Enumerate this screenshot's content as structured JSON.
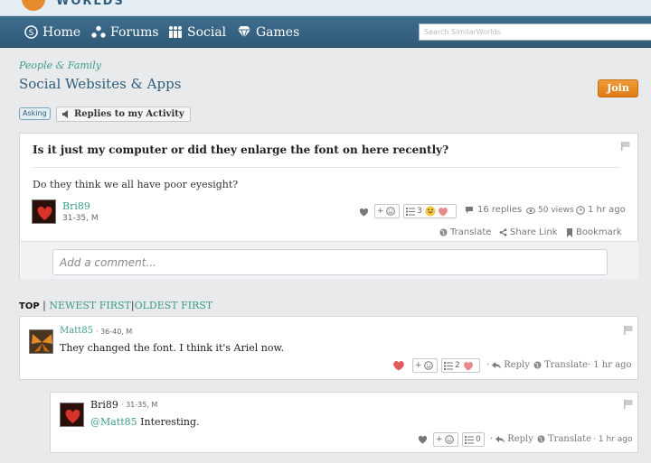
{
  "header": {
    "logo_text": "WORLDS",
    "nav": [
      {
        "label": "Home",
        "icon": "home-icon"
      },
      {
        "label": "Forums",
        "icon": "forums-icon"
      },
      {
        "label": "Social",
        "icon": "social-icon"
      },
      {
        "label": "Games",
        "icon": "games-icon"
      }
    ],
    "search_placeholder": "Search SimilarWorlds"
  },
  "group": {
    "category": "People & Family",
    "title": "Social Websites & Apps",
    "join_label": "Join"
  },
  "filters": {
    "asking_badge": "Asking",
    "replies_button": "Replies to my Activity"
  },
  "question": {
    "title": "Is it just my computer or did they enlarge the font on here recently?",
    "body": "Do they think we all have poor eyesight?",
    "author": {
      "name": "Bri89",
      "meta": "31-35, M"
    },
    "add_reaction": "+",
    "reactions_count": "3",
    "replies": "16 replies",
    "views": "50 views",
    "time": "1 hr ago",
    "translate": "Translate",
    "share": "Share Link",
    "bookmark": "Bookmark",
    "comment_placeholder": "Add a comment..."
  },
  "sort": {
    "top": "TOP",
    "newest": "NEWEST FIRST",
    "oldest": "OLDEST FIRST",
    "sep": "|"
  },
  "replies": [
    {
      "author": "Matt85",
      "meta": "· 36-40, M",
      "text": "They changed the font. I think it's Ariel now.",
      "add_reaction": "+",
      "reactions_count": "2",
      "reply": "Reply",
      "translate": "Translate",
      "time": "1 hr ago"
    },
    {
      "author": "Bri89",
      "meta": "· 31-35, M",
      "mention": "@Matt85",
      "text": " Interesting.",
      "add_reaction": "+",
      "reactions_count": "0",
      "reply": "Reply",
      "translate": "Translate",
      "time": "1 hr ago"
    }
  ],
  "colors": {
    "accent": "#3d9b8e",
    "nav": "#3a6686",
    "join": "#e8892b",
    "heart": "#e05a5a"
  }
}
